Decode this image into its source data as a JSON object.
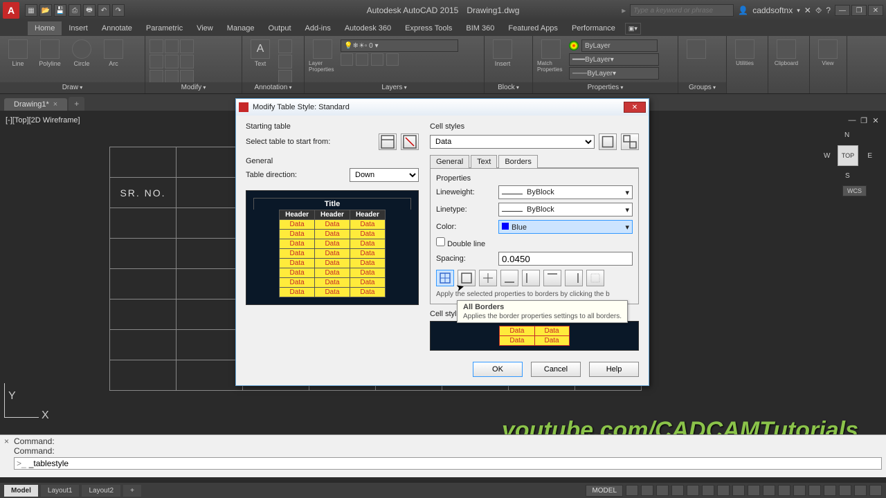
{
  "app": {
    "title": "Autodesk AutoCAD 2015",
    "doc": "Drawing1.dwg",
    "search_placeholder": "Type a keyword or phrase",
    "user": "caddsoftnx"
  },
  "ribbon_tabs": [
    "Home",
    "Insert",
    "Annotate",
    "Parametric",
    "View",
    "Manage",
    "Output",
    "Add-ins",
    "Autodesk 360",
    "Express Tools",
    "BIM 360",
    "Featured Apps",
    "Performance"
  ],
  "panels": {
    "draw": "Draw",
    "modify": "Modify",
    "annotation": "Annotation",
    "layers": "Layers",
    "block": "Block",
    "props": "Properties",
    "groups": "Groups",
    "utilities": "Utilities",
    "clipboard": "Clipboard",
    "view": "View"
  },
  "draw_tools": [
    "Line",
    "Polyline",
    "Circle",
    "Arc"
  ],
  "annot_tool": "Text",
  "layer_tool": "Layer Properties",
  "block_tool": "Insert",
  "match_tool": "Match Properties",
  "bylayer": "ByLayer",
  "doc_tab": "Drawing1*",
  "view_label": "[-][Top][2D Wireframe]",
  "table_header": "SR. NO.",
  "viewcube": {
    "top": "TOP",
    "n": "N",
    "s": "S",
    "e": "E",
    "w": "W",
    "wcs": "WCS"
  },
  "watermark": "youtube.com/CADCAMTutorials",
  "cmd": {
    "c1": "Command:",
    "c2": "Command:",
    "prompt": ">_",
    "entered": "_tablestyle"
  },
  "layouts": [
    "Model",
    "Layout1",
    "Layout2"
  ],
  "status_model": "MODEL",
  "dialog": {
    "title": "Modify Table Style: Standard",
    "starting_table": "Starting table",
    "select_table": "Select table to start from:",
    "general": "General",
    "table_direction": "Table direction:",
    "direction": "Down",
    "cell_styles": "Cell styles",
    "cell_style": "Data",
    "tabs": {
      "general": "General",
      "text": "Text",
      "borders": "Borders"
    },
    "properties": "Properties",
    "lineweight": "Lineweight:",
    "linetype": "Linetype:",
    "byblock": "ByBlock",
    "color": "Color:",
    "color_val": "Blue",
    "double_line": "Double line",
    "spacing": "Spacing:",
    "spacing_val": "0.0450",
    "apply_hint": "Apply the selected properties to borders by clicking the b",
    "cell_preview": "Cell style preview",
    "ok": "OK",
    "cancel": "Cancel",
    "help": "Help",
    "pv": {
      "title": "Title",
      "header": "Header",
      "data": "Data"
    }
  },
  "tooltip": {
    "title": "All Borders",
    "body": "Applies the border properties settings to all borders."
  }
}
